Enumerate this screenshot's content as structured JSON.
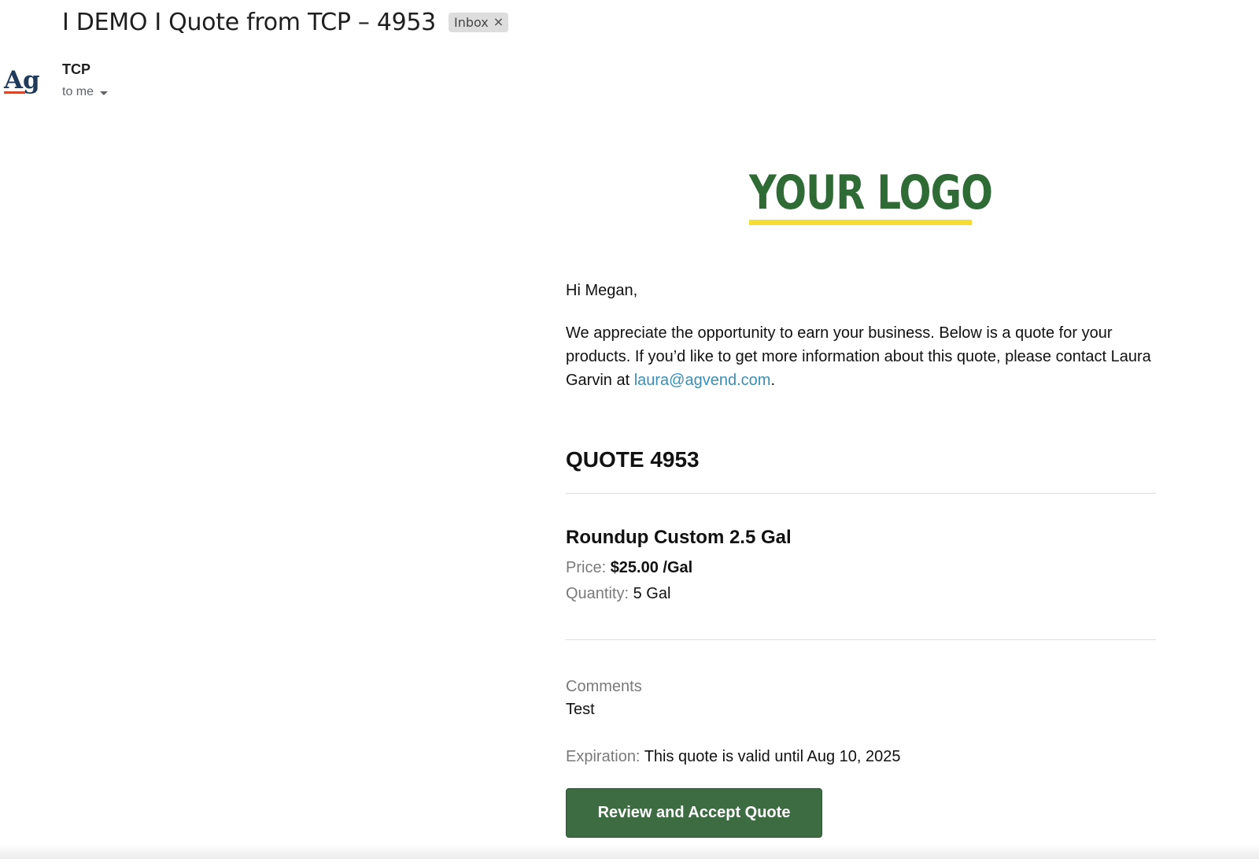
{
  "email": {
    "subject": "I DEMO I Quote from TCP – 4953",
    "label": "Inbox",
    "label_remove": "×",
    "avatar_text": "Ag",
    "sender": "TCP",
    "recipient": "to me"
  },
  "body": {
    "logo_text": "YOUR LOGO",
    "greeting": "Hi Megan,",
    "intro_text": "We appreciate the opportunity to earn your business. Below is a quote for your products. If you’d like to get more information about this quote, please contact Laura Garvin at ",
    "contact_email": "laura@agvend.com",
    "intro_end": ".",
    "quote_title": "QUOTE 4953",
    "product": {
      "name": "Roundup Custom 2.5 Gal",
      "price_label": "Price:",
      "price_value": "$25.00 /Gal",
      "quantity_label": "Quantity:",
      "quantity_value": "5 Gal"
    },
    "comments_label": "Comments",
    "comments_value": "Test",
    "expiration_label": "Expiration:",
    "expiration_value": "This quote is valid until Aug 10, 2025",
    "cta_label": "Review and Accept Quote"
  },
  "colors": {
    "logo_green": "#2f6b34",
    "logo_yellow": "#f5dd34",
    "link_blue": "#3a8fb7",
    "button_green": "#3d6c43",
    "avatar_navy": "#1f3a5a",
    "avatar_red": "#d9472b"
  }
}
